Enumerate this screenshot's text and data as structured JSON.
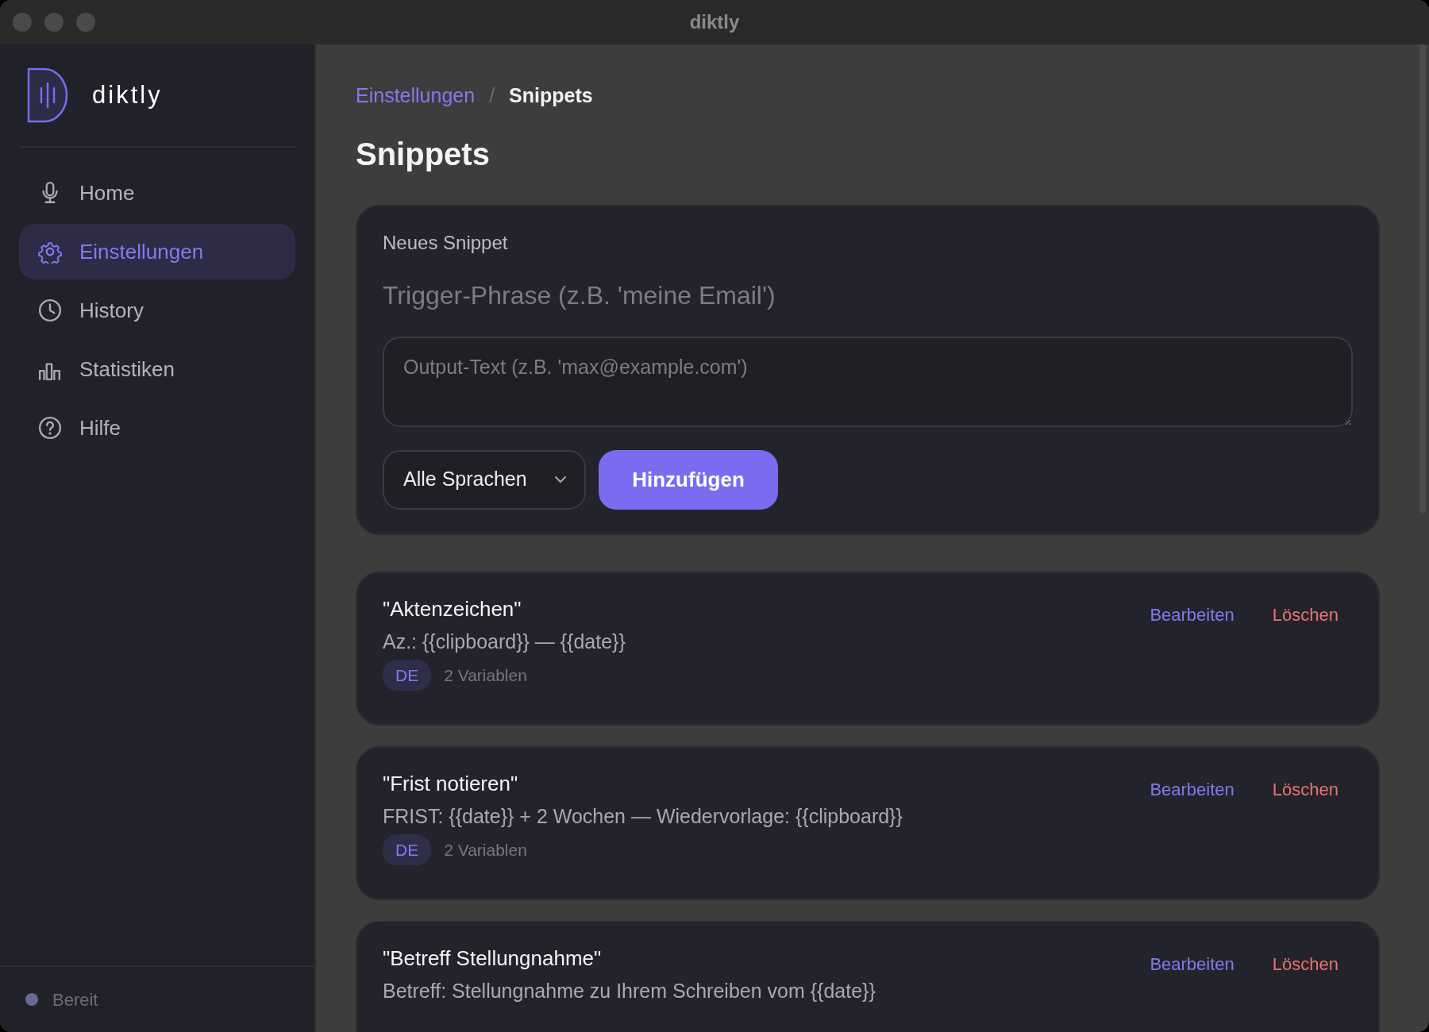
{
  "window": {
    "title": "diktly"
  },
  "sidebar": {
    "brand": "diktly",
    "items": [
      {
        "label": "Home",
        "selected": false
      },
      {
        "label": "Einstellungen",
        "selected": true
      },
      {
        "label": "History",
        "selected": false
      },
      {
        "label": "Statistiken",
        "selected": false
      },
      {
        "label": "Hilfe",
        "selected": false
      }
    ],
    "status": {
      "label": "Bereit",
      "color": "#6b6a8e"
    }
  },
  "breadcrumb": [
    {
      "label": "Einstellungen",
      "kind": "link"
    },
    {
      "label": "/",
      "kind": "separator"
    },
    {
      "label": "Snippets",
      "kind": "current"
    }
  ],
  "page_title": "Snippets",
  "new_snippet": {
    "heading": "Neues Snippet",
    "trigger": {
      "placeholder": "Trigger-Phrase (z.B. 'meine Email')"
    },
    "output": {
      "placeholder": "Output-Text (z.B. 'max@example.com')"
    },
    "language": {
      "value": "Alle Sprachen"
    },
    "add_button": "Hinzufügen"
  },
  "snippets": [
    {
      "trigger": "\"Aktenzeichen\"",
      "output": "Az.: {{clipboard}} — {{date}}",
      "language": "DE",
      "variables": "2 Variablen",
      "edit": "Bearbeiten",
      "delete": "Löschen"
    },
    {
      "trigger": "\"Frist notieren\"",
      "output": "FRIST: {{date}} + 2 Wochen — Wiedervorlage: {{clipboard}}",
      "language": "DE",
      "variables": "2 Variablen",
      "edit": "Bearbeiten",
      "delete": "Löschen"
    },
    {
      "trigger": "\"Betreff Stellungnahme\"",
      "output": "Betreff: Stellungnahme zu Ihrem Schreiben vom {{date}}",
      "edit": "Bearbeiten",
      "delete": "Löschen"
    }
  ]
}
